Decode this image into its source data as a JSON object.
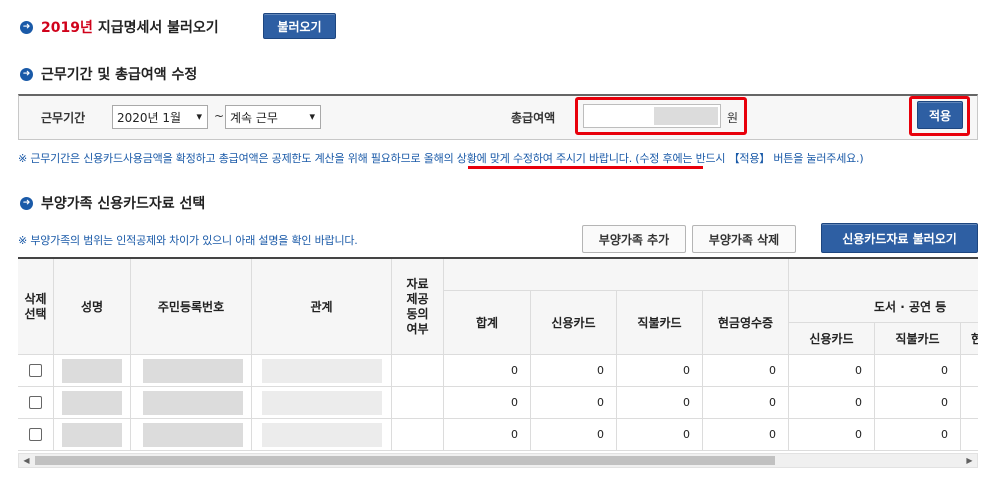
{
  "load_section": {
    "year": "2019년",
    "title": "지급명세서 불러오기",
    "load_button": "불러오기"
  },
  "period_section": {
    "title": "근무기간 및 총급여액 수정",
    "period_label": "근무기간",
    "start_select": "2020년 1월",
    "tilde": "~",
    "end_select": "계속 근무",
    "salary_label": "총급여액",
    "salary_unit": "원",
    "apply_button": "적용",
    "note_prefix": "※ 근무기간은 신용카드사용금액을 확정하고 총급여액은 공제한도 계산을 위해 필요하므로 ",
    "note_emphasis": "올해의 상황에 맞게 수정하여 주시기 바랍니다.",
    "note_suffix": " (수정 후에는 반드시 【적용】 버튼을 눌러주세요.)"
  },
  "dependents_section": {
    "title": "부양가족 신용카드자료 선택",
    "note": "※ 부양가족의 범위는 인적공제와 차이가 있으니 아래 설명을 확인 바랍니다.",
    "add_button": "부양가족 추가",
    "delete_button": "부양가족 삭제",
    "load_card_button": "신용카드자료 불러오기"
  },
  "table": {
    "headers": {
      "delete_select": "삭제\n선택",
      "name": "성명",
      "rrn": "주민등록번호",
      "relation": "관계",
      "data_share": "자료\n제공\n동의\n여부",
      "total": "합계",
      "credit_card": "신용카드",
      "debit_card": "직불카드",
      "cash_receipt": "현금영수증",
      "books_group": "도서 · 공연 등",
      "books_credit": "신용카드",
      "books_debit": "직불카드",
      "books_cash_partial": "현"
    },
    "rows": [
      {
        "total": "0",
        "credit": "0",
        "debit": "0",
        "cash": "0",
        "books_credit": "0",
        "books_debit": "0"
      },
      {
        "total": "0",
        "credit": "0",
        "debit": "0",
        "cash": "0",
        "books_credit": "0",
        "books_debit": "0"
      },
      {
        "total": "0",
        "credit": "0",
        "debit": "0",
        "cash": "0",
        "books_credit": "0",
        "books_debit": "0"
      }
    ]
  },
  "colors": {
    "accent_blue": "#2e5fa3",
    "highlight_red": "#e8000b",
    "note_blue": "#1a5aa8"
  }
}
